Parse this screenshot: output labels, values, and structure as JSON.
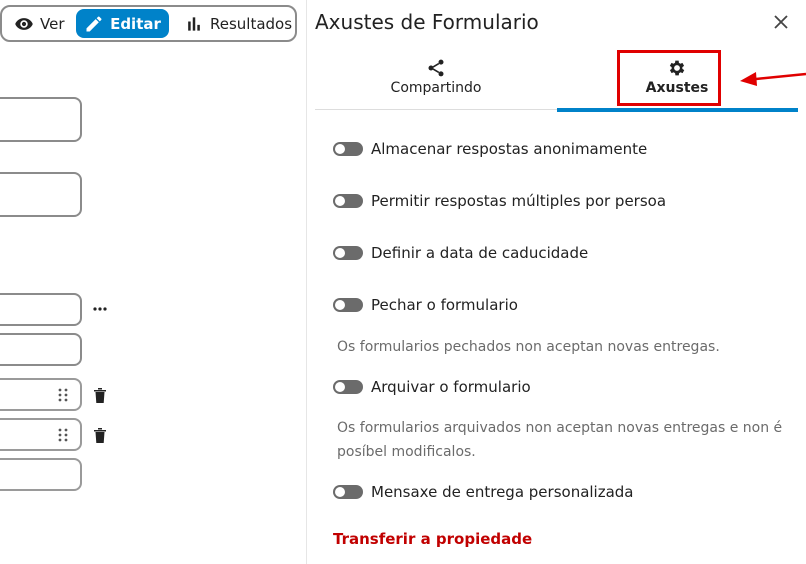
{
  "mode_switch": {
    "view_label": "Ver",
    "edit_label": "Editar",
    "results_label": "Resultados"
  },
  "sidebar": {
    "title": "Axustes de Formulario",
    "tabs": [
      {
        "label": "Compartindo",
        "icon": "share-icon"
      },
      {
        "label": "Axustes",
        "icon": "gear-icon",
        "active": true
      }
    ],
    "settings": [
      {
        "label": "Almacenar respostas anonimamente",
        "enabled": false
      },
      {
        "label": "Permitir respostas múltiples por persoa",
        "enabled": false
      },
      {
        "label": "Definir a data de caducidade",
        "enabled": false
      },
      {
        "label": "Pechar o formulario",
        "enabled": false,
        "hint": "Os formularios pechados non aceptan novas entregas."
      },
      {
        "label": "Arquivar o formulario",
        "enabled": false,
        "hint": "Os formularios arquivados non aceptan novas entregas e non é posíbel modificalos."
      },
      {
        "label": "Mensaxe de entrega personalizada",
        "enabled": false
      }
    ],
    "transfer_label": "Transferir a propiedade"
  },
  "colors": {
    "accent": "#0082c9",
    "annotation": "#e00000",
    "danger": "#c10000",
    "toggle_off": "#6b6b6b"
  }
}
